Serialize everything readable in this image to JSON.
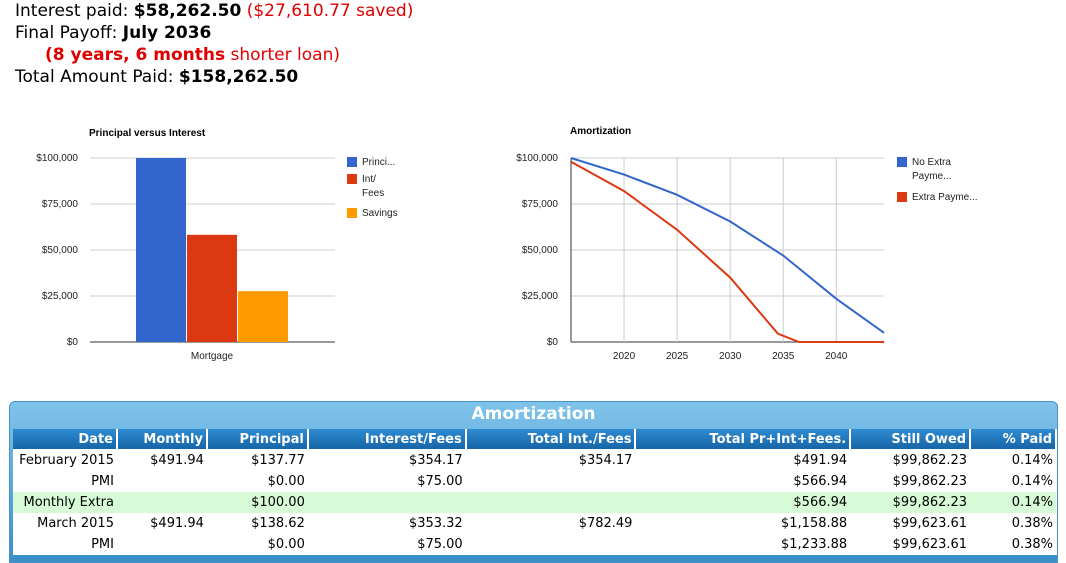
{
  "summary": {
    "interest_label": "Interest paid:",
    "interest_value": "$58,262.50",
    "interest_saved": "($27,610.77 saved)",
    "payoff_label": "Final Payoff:",
    "payoff_value": "July 2036",
    "shorter_bold": "(8 years, 6 months",
    "shorter_rest": "shorter loan)",
    "total_label": "Total Amount Paid:",
    "total_value": "$158,262.50"
  },
  "charts": [
    {
      "type": "bar",
      "title": "Principal versus Interest",
      "categories": [
        "Mortgage"
      ],
      "series": [
        {
          "name": "Princi...",
          "values": [
            100000
          ],
          "color": "#3366cc"
        },
        {
          "name": "Int/ Fees",
          "values": [
            58262.5
          ],
          "color": "#dc3912"
        },
        {
          "name": "Savings",
          "values": [
            27610.77
          ],
          "color": "#ff9900"
        }
      ],
      "ylim": [
        0,
        100000
      ],
      "yticks": [
        "$0",
        "$25,000",
        "$50,000",
        "$75,000",
        "$100,000"
      ],
      "legend": "right"
    },
    {
      "type": "line",
      "title": "Amortization",
      "xticks": [
        "2020",
        "2025",
        "2030",
        "2035",
        "2040"
      ],
      "yticks": [
        "$0",
        "$25,000",
        "$50,000",
        "$75,000",
        "$100,000"
      ],
      "ylim": [
        0,
        100000
      ],
      "xlim": [
        2015,
        2044.5
      ],
      "series": [
        {
          "name": "No Extra Payme...",
          "color": "#3366cc",
          "x": [
            2015,
            2020,
            2025,
            2030,
            2035,
            2040,
            2044.5
          ],
          "y": [
            100000,
            91000,
            80000,
            65500,
            47000,
            23500,
            5000
          ]
        },
        {
          "name": "Extra Payme...",
          "color": "#dc3912",
          "x": [
            2015,
            2020,
            2025,
            2030,
            2034.5,
            2036.5,
            2044.5
          ],
          "y": [
            98000,
            82000,
            61000,
            35000,
            4500,
            0,
            0
          ]
        }
      ],
      "legend": "right"
    }
  ],
  "table": {
    "title": "Amortization",
    "columns": [
      "Date",
      "Monthly",
      "Principal",
      "Interest/Fees",
      "Total Int./Fees",
      "Total Pr+Int+Fees.",
      "Still Owed",
      "% Paid"
    ],
    "rows": [
      {
        "extra": false,
        "cells": [
          "February 2015",
          "$491.94",
          "$137.77",
          "$354.17",
          "$354.17",
          "$491.94",
          "$99,862.23",
          "0.14%"
        ]
      },
      {
        "extra": false,
        "cells": [
          "PMI",
          "",
          "$0.00",
          "$75.00",
          "",
          "$566.94",
          "$99,862.23",
          "0.14%"
        ]
      },
      {
        "extra": true,
        "cells": [
          "Monthly Extra",
          "",
          "$100.00",
          "",
          "",
          "$566.94",
          "$99,862.23",
          "0.14%"
        ]
      },
      {
        "extra": false,
        "cells": [
          "March 2015",
          "$491.94",
          "$138.62",
          "$353.32",
          "$782.49",
          "$1,158.88",
          "$99,623.61",
          "0.38%"
        ]
      },
      {
        "extra": false,
        "cells": [
          "PMI",
          "",
          "$0.00",
          "$75.00",
          "",
          "$1,233.88",
          "$99,623.61",
          "0.38%"
        ]
      }
    ]
  }
}
